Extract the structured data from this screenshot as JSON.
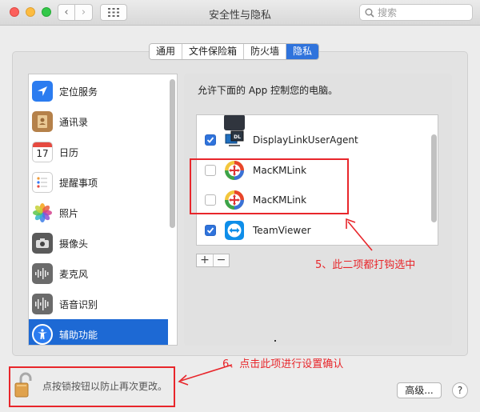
{
  "window": {
    "title": "安全性与隐私"
  },
  "search": {
    "placeholder": "搜索"
  },
  "tabs": [
    {
      "label": "通用",
      "active": false
    },
    {
      "label": "文件保险箱",
      "active": false
    },
    {
      "label": "防火墙",
      "active": false
    },
    {
      "label": "隐私",
      "active": true
    }
  ],
  "sidebar": {
    "items": [
      {
        "label": "定位服务",
        "icon": "location-icon",
        "selected": false
      },
      {
        "label": "通讯录",
        "icon": "contacts-icon",
        "selected": false
      },
      {
        "label": "日历",
        "icon": "calendar-icon",
        "selected": false,
        "icon_text": "17"
      },
      {
        "label": "提醒事项",
        "icon": "reminders-icon",
        "selected": false
      },
      {
        "label": "照片",
        "icon": "photos-icon",
        "selected": false
      },
      {
        "label": "摄像头",
        "icon": "camera-icon",
        "selected": false
      },
      {
        "label": "麦克风",
        "icon": "microphone-icon",
        "selected": false
      },
      {
        "label": "语音识别",
        "icon": "speech-recognition-icon",
        "selected": false
      },
      {
        "label": "辅助功能",
        "icon": "accessibility-icon",
        "selected": true
      }
    ]
  },
  "main": {
    "description": "允许下面的 App 控制您的电脑。",
    "apps": [
      {
        "name": "DisplayLinkUserAgent",
        "checked": true,
        "icon": "displaylink-icon",
        "icon_text": "DL"
      },
      {
        "name": "MacKMLink",
        "checked": false,
        "icon": "mackmlink-icon"
      },
      {
        "name": "MacKMLink",
        "checked": false,
        "icon": "mackmlink-icon"
      },
      {
        "name": "TeamViewer",
        "checked": true,
        "icon": "teamviewer-icon"
      }
    ],
    "add_label": "+",
    "remove_label": "−"
  },
  "annotations": {
    "step5": "5、此二项都打钩选中",
    "step6": "6、点击此项进行设置确认"
  },
  "footer": {
    "lock_text": "点按锁按钮以防止再次更改。",
    "advanced_label": "高级...",
    "help_label": "?"
  },
  "colors": {
    "accent": "#2f73dc",
    "selection": "#1d69d4",
    "annotation": "#e8262b"
  }
}
